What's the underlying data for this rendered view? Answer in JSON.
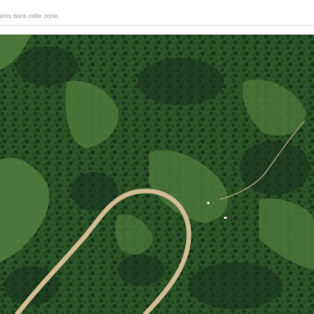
{
  "notice": {
    "text": "aires dans cette zone."
  },
  "map": {
    "view_type": "satellite",
    "features": [
      "forest",
      "meadow",
      "dirt-road",
      "track"
    ],
    "colors": {
      "forest_dark": "#1f3f1c",
      "forest_mid": "#2f5a2b",
      "meadow": "#4f7a3c",
      "meadow_light": "#5f8a48",
      "road": "#c9b48c"
    }
  }
}
